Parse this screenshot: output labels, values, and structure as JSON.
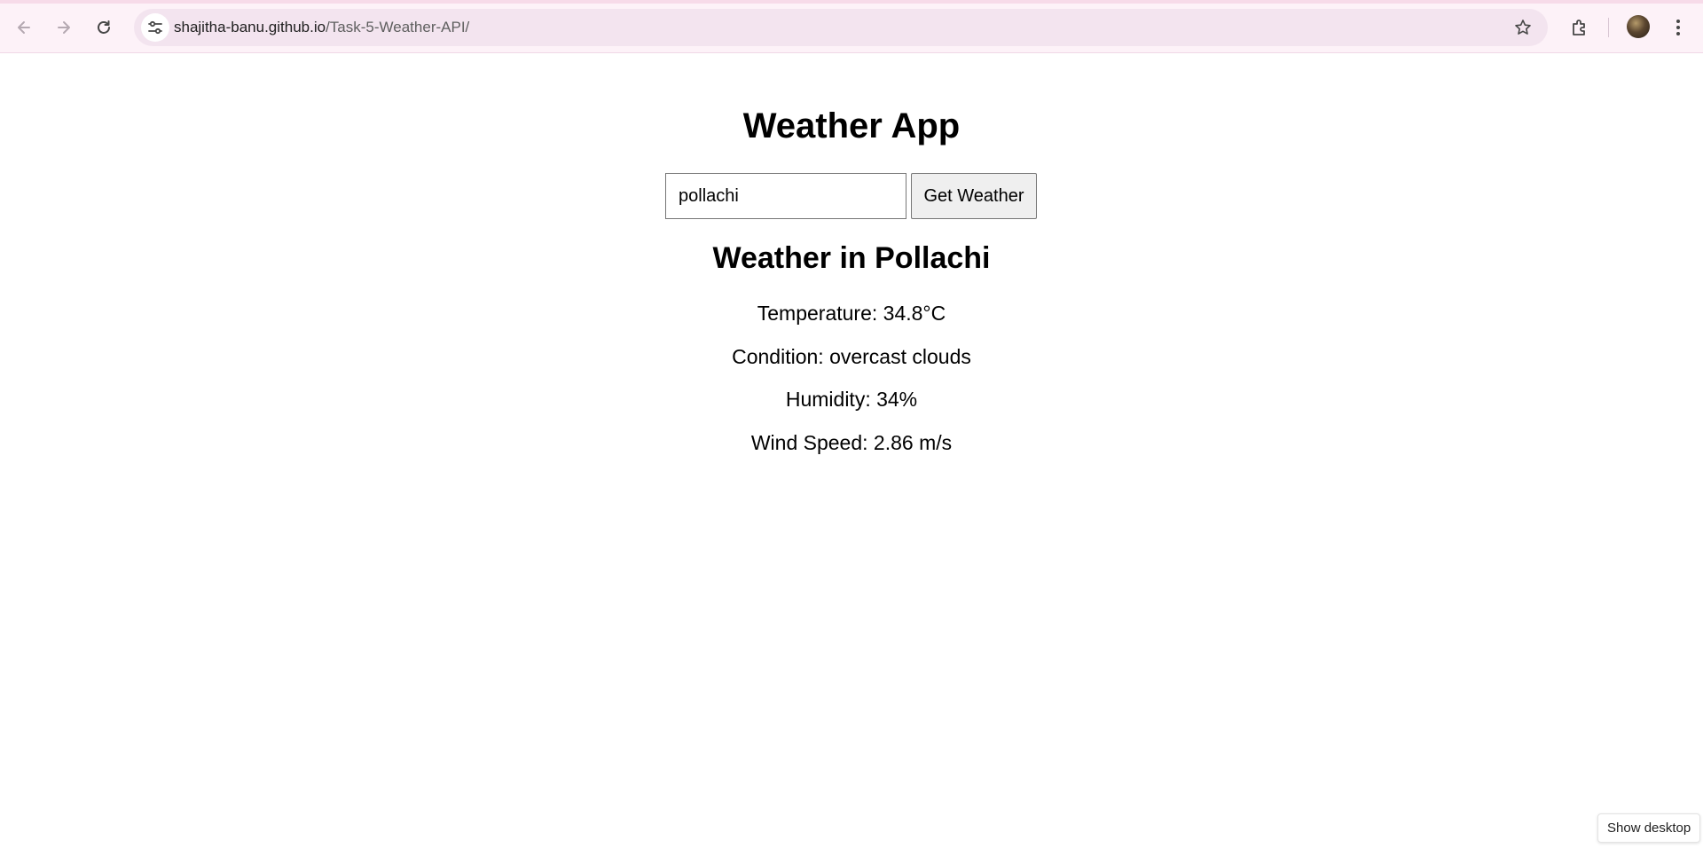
{
  "browser": {
    "url_host": "shajitha-banu.github.io",
    "url_path": "/Task-5-Weather-API/",
    "icons": {
      "back": "back-arrow-icon",
      "forward": "forward-arrow-icon",
      "reload": "reload-icon",
      "site_info": "tune-icon",
      "bookmark": "star-icon",
      "extensions": "puzzle-icon",
      "menu": "kebab-menu-icon"
    }
  },
  "app": {
    "title": "Weather App",
    "search": {
      "value": "pollachi",
      "button_label": "Get Weather"
    },
    "result": {
      "heading": "Weather in Pollachi",
      "temperature": "Temperature: 34.8°C",
      "condition": "Condition: overcast clouds",
      "humidity": "Humidity: 34%",
      "wind": "Wind Speed: 2.86 m/s"
    }
  },
  "system": {
    "tooltip": "Show desktop"
  }
}
